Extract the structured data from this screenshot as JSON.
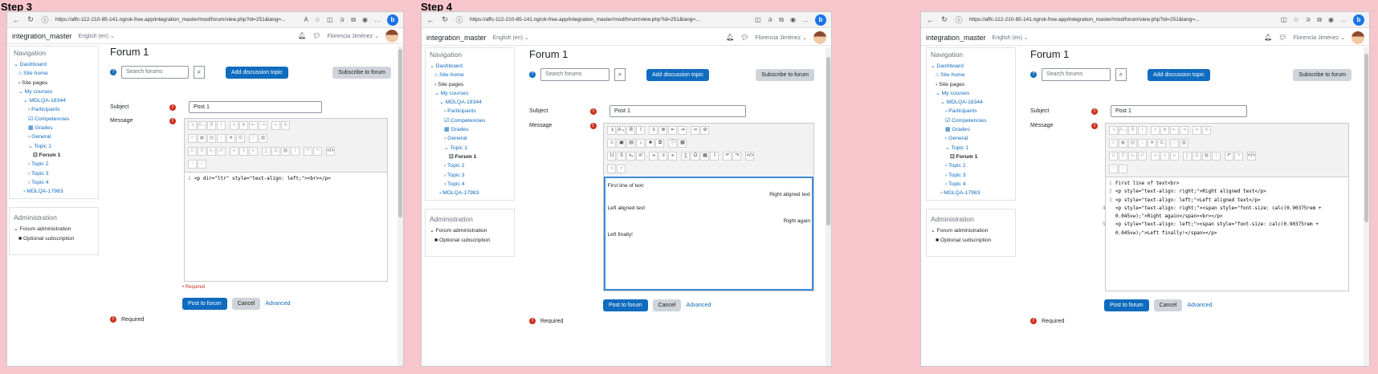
{
  "steps": [
    {
      "label": "Step 3",
      "url": "https://affc-112-210-85-141.ngrok-free.app/integration_master/mod/forum/view.php?id=251&lang=...",
      "mode": "source",
      "source_lines": [
        "<p dir=\"ltr\" style=\"text-align: left;\"><br></p>"
      ]
    },
    {
      "label": "Step 4",
      "url": "https://affc-112-210-85-141.ngrok-free.app/integration_master/mod/forum/view.php?id=251&lang=...",
      "mode": "wysiwyg",
      "wysiwyg": [
        {
          "text": "First line of text",
          "align": "left"
        },
        {
          "text": "Right aligned text",
          "align": "right"
        },
        {
          "text": "Left aligned text",
          "align": "left"
        },
        {
          "text": "Right again",
          "align": "right"
        },
        {
          "text": "Left finally!",
          "align": "left"
        }
      ]
    },
    {
      "label": "",
      "url": "https://affc-112-210-85-141.ngrok-free.app/integration_master/mod/forum/view.php?id=251&lang=...",
      "mode": "source",
      "source_lines": [
        "First line of text<br>",
        "<p style=\"text-align: right;\">Right aligned text</p>",
        "<p style=\"text-align: left;\">Left aligned text</p>",
        "<p style=\"text-align: right;\"><span style=\"font-size: calc(0.90375rem + 0.045vw);\">Right again</span><br></p>",
        "<p style=\"text-align: left;\"><span style=\"font-size: calc(0.90375rem + 0.045vw);\">Left finally!</span></p>"
      ]
    }
  ],
  "site": {
    "brand": "integration_master",
    "language": "English (en) ⌄",
    "user": "Florencia Jiménez ⌄"
  },
  "nav": {
    "title": "Navigation",
    "items": [
      "Dashboard",
      "Site home",
      "Site pages",
      "My courses",
      "MDLQA-18344",
      "Participants",
      "Competencies",
      "Grades",
      "General",
      "Topic 1",
      "Forum 1",
      "Topic 2",
      "Topic 3",
      "Topic 4",
      "MDLQA-17983"
    ]
  },
  "admin": {
    "title": "Administration",
    "forum_admin": "Forum administration",
    "optional_sub": "Optional subscription"
  },
  "main": {
    "title": "Forum 1",
    "search_placeholder": "Search forums",
    "add_topic": "Add discussion topic",
    "subscribe": "Subscribe to forum",
    "subject_label": "Subject",
    "subject_value": "Post 1",
    "message_label": "Message",
    "required_note": "• Required",
    "post_btn": "Post to forum",
    "cancel_btn": "Cancel",
    "advanced_link": "Advanced",
    "required": "Required"
  },
  "colors": {
    "primary": "#0f6cbf",
    "error": "#ca3120",
    "background": "#f7c6cc"
  }
}
